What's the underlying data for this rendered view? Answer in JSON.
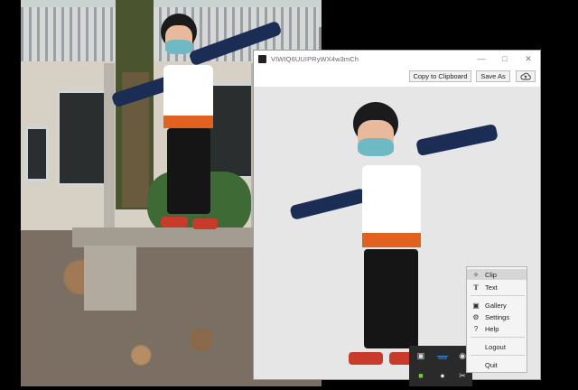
{
  "window": {
    "title": "VIWIQ6UUIPRyWX4w3mCh",
    "minimize_icon": "minimize-icon",
    "maximize_icon": "maximize-icon",
    "close_icon": "close-icon"
  },
  "toolbar": {
    "copy_label": "Copy to Clipboard",
    "save_label": "Save As",
    "upload_icon": "cloud-upload-icon"
  },
  "menu": {
    "items": [
      {
        "label": "Clip",
        "icon": "scissors-icon"
      },
      {
        "label": "Text",
        "icon": "text-icon"
      },
      {
        "label": "Gallery",
        "icon": "gallery-icon"
      },
      {
        "label": "Settings",
        "icon": "gear-icon"
      },
      {
        "label": "Help",
        "icon": "help-icon"
      },
      {
        "label": "Logout",
        "icon": ""
      },
      {
        "label": "Quit",
        "icon": ""
      }
    ]
  },
  "colors": {
    "window_bg": "#e6e6e6",
    "menu_bg": "#f4f4f4",
    "menu_active": "#d6d6d6",
    "tray_bg": "#2a2a2a"
  }
}
